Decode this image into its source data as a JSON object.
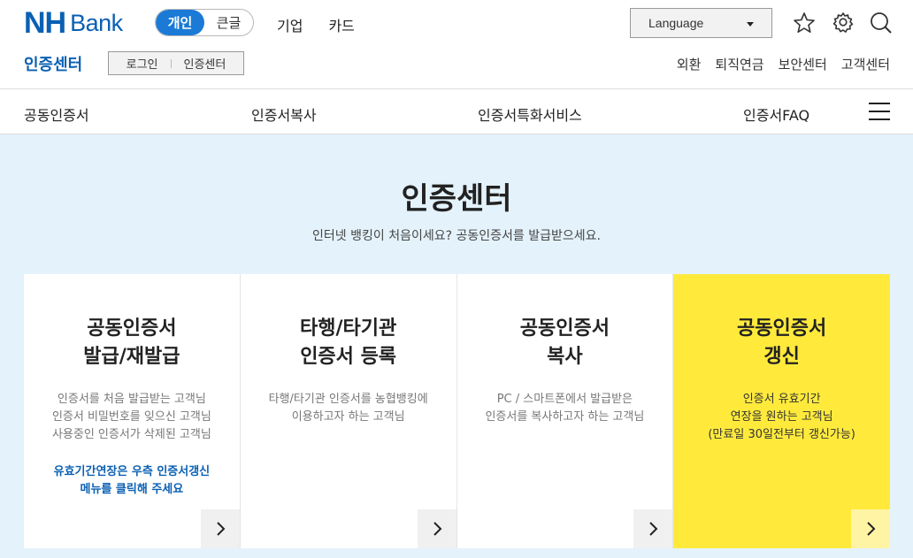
{
  "header": {
    "logo_nh": "NH",
    "logo_bank": "Bank",
    "view_toggle": [
      "개인",
      "큰글"
    ],
    "topnav": [
      "기업",
      "카드"
    ],
    "language_label": "Language",
    "subtitle": "인증센터",
    "login_box": [
      "로그인",
      "인증센터"
    ],
    "utility_links": [
      "외환",
      "퇴직연금",
      "보안센터",
      "고객센터"
    ]
  },
  "nav": {
    "items": [
      "공동인증서",
      "인증서복사",
      "인증서특화서비스",
      "인증서FAQ"
    ]
  },
  "main": {
    "title": "인증센터",
    "description": "인터넷 뱅킹이 처음이세요? 공동인증서를 발급받으세요.",
    "cards": [
      {
        "title1": "공동인증서",
        "title2": "발급/재발급",
        "desc": [
          "인증서를 처음 발급받는 고객님",
          "인증서 비밀번호를 잊으신 고객님",
          "사용중인 인증서가 삭제된 고객님"
        ],
        "note": [
          "유효기간연장은 우측 인증서갱신",
          "메뉴를 클릭해 주세요"
        ]
      },
      {
        "title1": "타행/타기관",
        "title2": "인증서 등록",
        "desc": [
          "타행/타기관 인증서를 농협뱅킹에",
          "이용하고자 하는 고객님",
          ""
        ],
        "note": [
          "",
          ""
        ]
      },
      {
        "title1": "공동인증서",
        "title2": "복사",
        "desc": [
          "PC / 스마트폰에서 발급받은",
          "인증서를 복사하고자 하는 고객님",
          ""
        ],
        "note": [
          "",
          ""
        ]
      },
      {
        "title1": "공동인증서",
        "title2": "갱신",
        "desc": [
          "인증서 유효기간",
          "연장을 원하는 고객님",
          "(만료일 30일전부터 갱신가능)"
        ],
        "note": [
          "",
          ""
        ]
      }
    ]
  },
  "colors": {
    "brand_blue": "#0a60b3",
    "toggle_blue": "#1a7ad6",
    "highlight_yellow": "#ffea3c",
    "main_bg": "#e4f2fb"
  },
  "icons": [
    "star-icon",
    "gear-icon",
    "search-icon",
    "menu-icon",
    "chevron-right-icon",
    "caret-down-icon"
  ]
}
